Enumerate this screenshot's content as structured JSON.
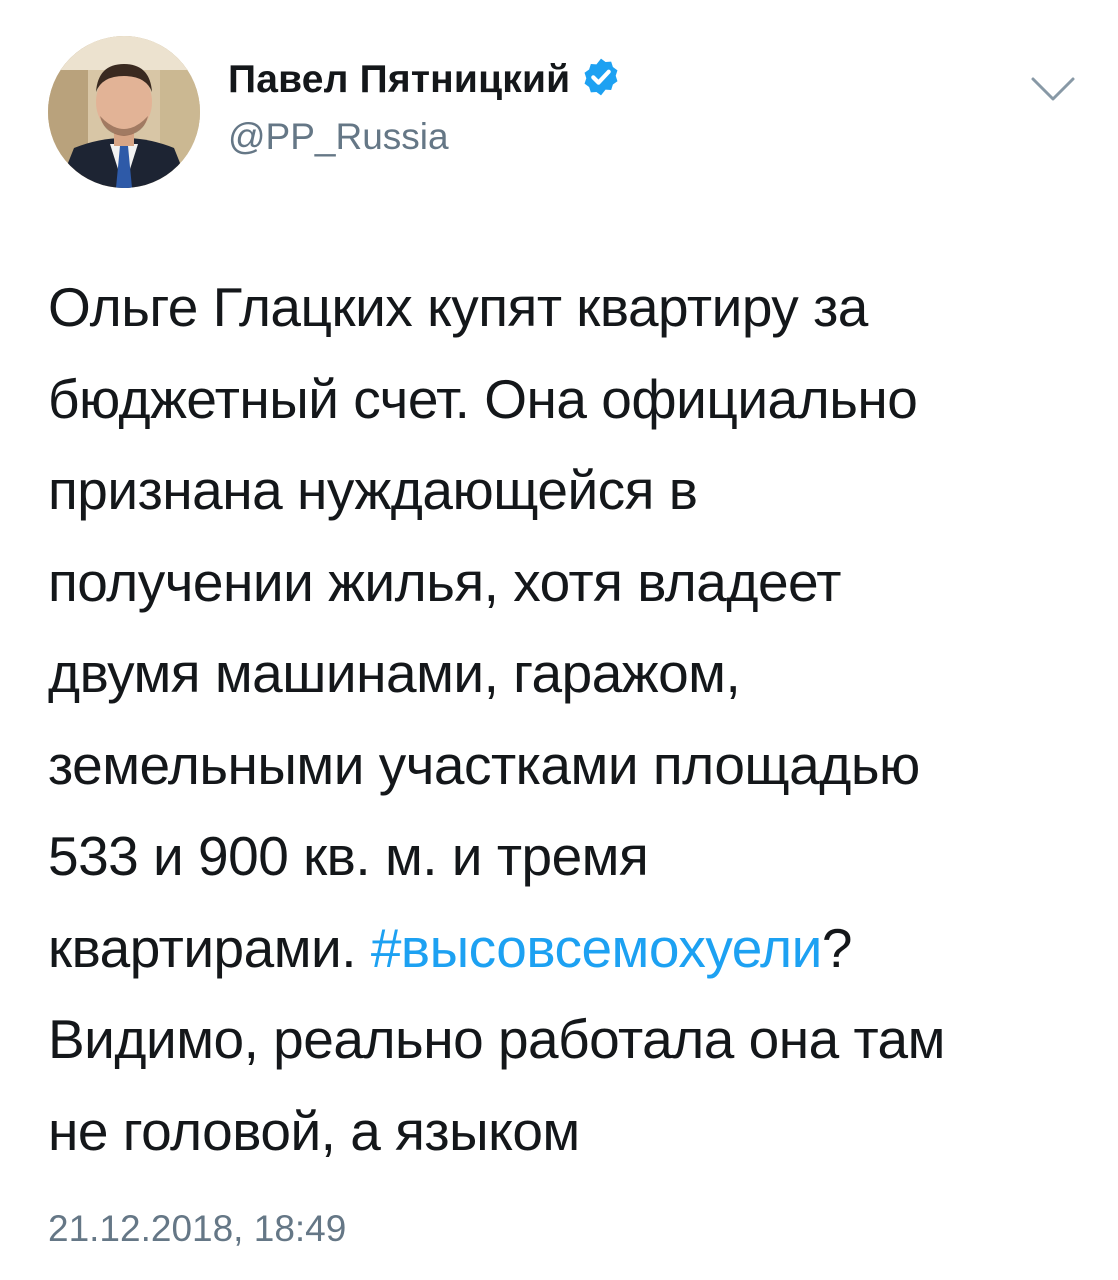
{
  "author": {
    "name": "Павел Пятницкий",
    "handle": "@PP_Russia",
    "verified": true,
    "verified_color": "#1da1f2"
  },
  "menu": {
    "icon": "chevron-down-icon"
  },
  "tweet": {
    "lines": [
      "Ольге Глацких купят квартиру за",
      "бюджетный счет. Она официально",
      "признана нуждающейся в",
      "получении жилья, хотя владеет",
      "двумя машинами, гаражом,",
      "земельными участками площадью",
      "533 и 900 кв. м. и тремя"
    ],
    "line_with_hashtag": {
      "before": "квартирами. ",
      "hashtag": "#высовсемохуели",
      "after": "?"
    },
    "lines_after": [
      "Видимо, реально работала она там",
      "не головой, а языком"
    ],
    "hashtag_color": "#1da1f2"
  },
  "timestamp": "21.12.2018, 18:49"
}
